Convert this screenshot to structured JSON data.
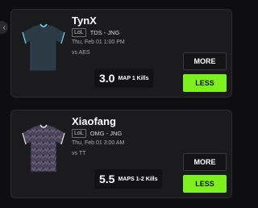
{
  "cards": [
    {
      "player": "TynX",
      "league": "LoL",
      "team_position": "TDS - JNG",
      "time": "Thu, Feb 01 1:00 PM",
      "opponent": "vs AES",
      "projection": "3.0",
      "stat": "MAP 1 Kills",
      "more_label": "MORE",
      "less_label": "LESS",
      "jersey_color": "#2b3a45"
    },
    {
      "player": "Xiaofang",
      "league": "LoL",
      "team_position": "OMG - JNG",
      "time": "Thu, Feb 01 3:00 AM",
      "opponent": "vs TT",
      "projection": "5.5",
      "stat": "MAPS 1-2 Kills",
      "more_label": "MORE",
      "less_label": "LESS",
      "jersey_color": "#4a4458"
    }
  ],
  "accent": "#7df01e"
}
